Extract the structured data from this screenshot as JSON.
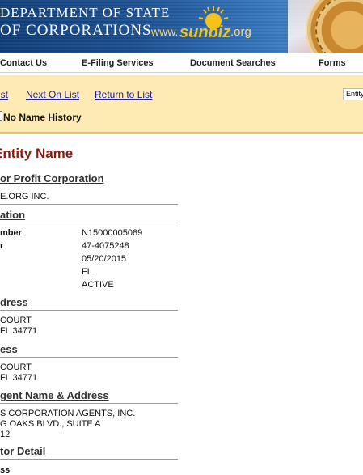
{
  "banner": {
    "line1": "DEPARTMENT OF STATE",
    "line2": "OF CORPORATIONS",
    "logo_text": "www.sunbiz.org"
  },
  "nav": {
    "items": [
      "Contact Us",
      "E-Filing Services",
      "Document Searches",
      "Forms"
    ]
  },
  "controls": {
    "prev_link": "ist",
    "next_link": "Next On List",
    "return_link": "Return to List",
    "entity_button": "Entity",
    "no_name_history": "No Name History"
  },
  "page_title": "Entity Name",
  "corporation": {
    "section": "or Profit Corporation",
    "name": "E.ORG INC."
  },
  "filing": {
    "section": "ation",
    "rows": [
      {
        "label": "mber",
        "value": "N15000005089"
      },
      {
        "label": "r",
        "value": "47-4075248"
      },
      {
        "label": "",
        "value": "05/20/2015"
      },
      {
        "label": "",
        "value": "FL"
      },
      {
        "label": "",
        "value": "ACTIVE"
      }
    ]
  },
  "principal_address": {
    "section": "dress",
    "line1": "COURT",
    "line2": "FL 34771"
  },
  "mailing_address": {
    "section": "ess",
    "line1": "COURT",
    "line2": "FL 34771"
  },
  "registered_agent": {
    "section": "gent Name & Address",
    "line1": "S CORPORATION AGENTS, INC.",
    "line2": "G OAKS BLVD., SUITE A",
    "line3": "12"
  },
  "officer": {
    "section": "tor Detail",
    "line1": "ss"
  }
}
